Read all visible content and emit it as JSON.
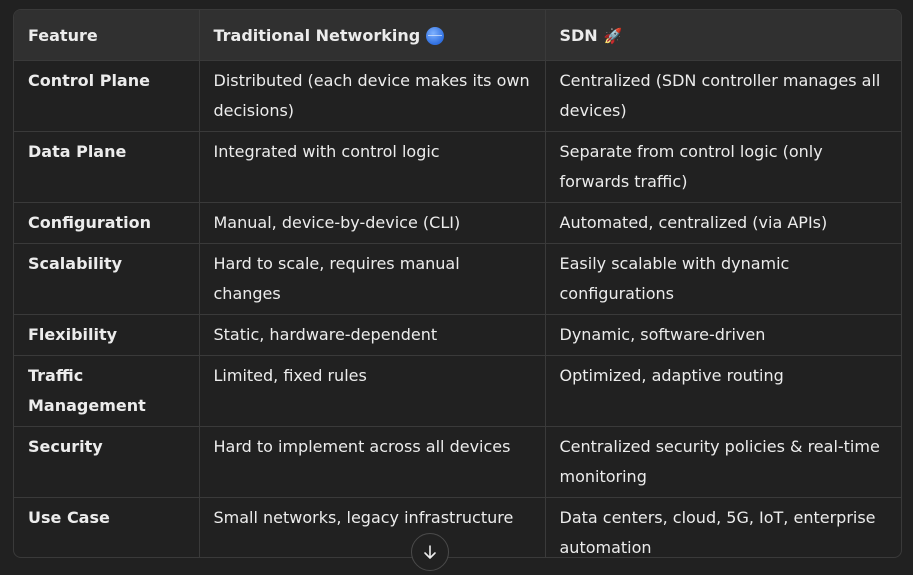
{
  "table": {
    "headers": [
      "Feature",
      "Traditional Networking",
      "SDN"
    ],
    "header_icons": [
      "",
      "globe-icon",
      "rocket-icon"
    ],
    "rows": [
      [
        "Control Plane",
        "Distributed (each device makes its own decisions)",
        "Centralized (SDN controller manages all devices)"
      ],
      [
        "Data Plane",
        "Integrated with control logic",
        "Separate from control logic (only forwards traffic)"
      ],
      [
        "Configuration",
        "Manual, device-by-device (CLI)",
        "Automated, centralized (via APIs)"
      ],
      [
        "Scalability",
        "Hard to scale, requires manual changes",
        "Easily scalable with dynamic configurations"
      ],
      [
        "Flexibility",
        "Static, hardware-dependent",
        "Dynamic, software-driven"
      ],
      [
        "Traffic Management",
        "Limited, fixed rules",
        "Optimized, adaptive routing"
      ],
      [
        "Security",
        "Hard to implement across all devices",
        "Centralized security policies & real-time monitoring"
      ],
      [
        "Use Case",
        "Small networks, legacy infrastructure",
        "Data centers, cloud, 5G, IoT, enterprise automation"
      ]
    ]
  },
  "scroll_button": {
    "icon": "arrow-down-icon"
  },
  "colors": {
    "background": "#212121",
    "header_background": "#303030",
    "border": "#3a3a3a",
    "text": "#ececec"
  }
}
